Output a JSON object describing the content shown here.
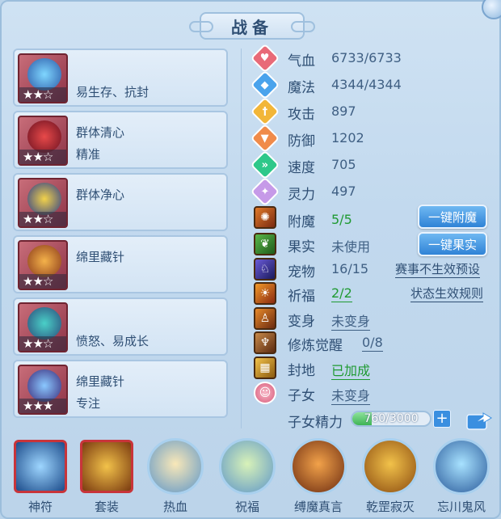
{
  "window": {
    "title": "战备"
  },
  "skills": [
    {
      "name": "",
      "desc": "易生存、抗封",
      "stars": "★★☆"
    },
    {
      "name": "群体清心",
      "desc": "精准",
      "stars": "★★☆"
    },
    {
      "name": "群体净心",
      "desc": "",
      "stars": "★★☆"
    },
    {
      "name": "绵里藏针",
      "desc": "",
      "stars": "★★☆"
    },
    {
      "name": "",
      "desc": "愤怒、易成长",
      "stars": "★★☆"
    },
    {
      "name": "绵里藏针",
      "desc": "专注",
      "stars": "★★★"
    }
  ],
  "attributes": [
    {
      "label": "气血",
      "value": "6733/6733",
      "icon": "heart-icon",
      "color": "#e86a78"
    },
    {
      "label": "魔法",
      "value": "4344/4344",
      "icon": "mana-icon",
      "color": "#4aa3ec"
    },
    {
      "label": "攻击",
      "value": "897",
      "icon": "sword-icon",
      "color": "#f2b638"
    },
    {
      "label": "防御",
      "value": "1202",
      "icon": "shield-icon",
      "color": "#f08b4a"
    },
    {
      "label": "速度",
      "value": "705",
      "icon": "speed-icon",
      "color": "#2ec88a"
    },
    {
      "label": "灵力",
      "value": "497",
      "icon": "spirit-icon",
      "color": "#c69ae8"
    }
  ],
  "rows": {
    "enchant": {
      "label": "附魔",
      "value": "5/5"
    },
    "fruit": {
      "label": "果实",
      "value": "未使用"
    },
    "pet": {
      "label": "宠物",
      "value": "16/15"
    },
    "bless": {
      "label": "祈福",
      "value": "2/2"
    },
    "transform": {
      "label": "变身",
      "value": "未变身"
    },
    "awaken": {
      "label": "修炼觉醒",
      "value": "0/8"
    },
    "fief": {
      "label": "封地",
      "value": "已加成"
    },
    "child": {
      "label": "子女",
      "value": "未变身"
    }
  },
  "buttons": {
    "auto_enchant": "一键附魔",
    "auto_fruit": "一键果实",
    "event_preset": "赛事不生效预设",
    "status_rules": "状态生效规则"
  },
  "energy": {
    "label": "子女精力",
    "value": "760/3000",
    "fraction": 0.253
  },
  "bottom_tabs": [
    {
      "label": "神符",
      "icon": "rune-icon"
    },
    {
      "label": "套装",
      "icon": "set-icon"
    },
    {
      "label": "热血",
      "icon": "passion-icon"
    },
    {
      "label": "祝福",
      "icon": "blessing-icon"
    },
    {
      "label": "缚魔真言",
      "icon": "binding-icon"
    },
    {
      "label": "乾罡寂灭",
      "icon": "annihilation-icon"
    },
    {
      "label": "忘川鬼风",
      "icon": "ghost-wind-icon"
    }
  ]
}
